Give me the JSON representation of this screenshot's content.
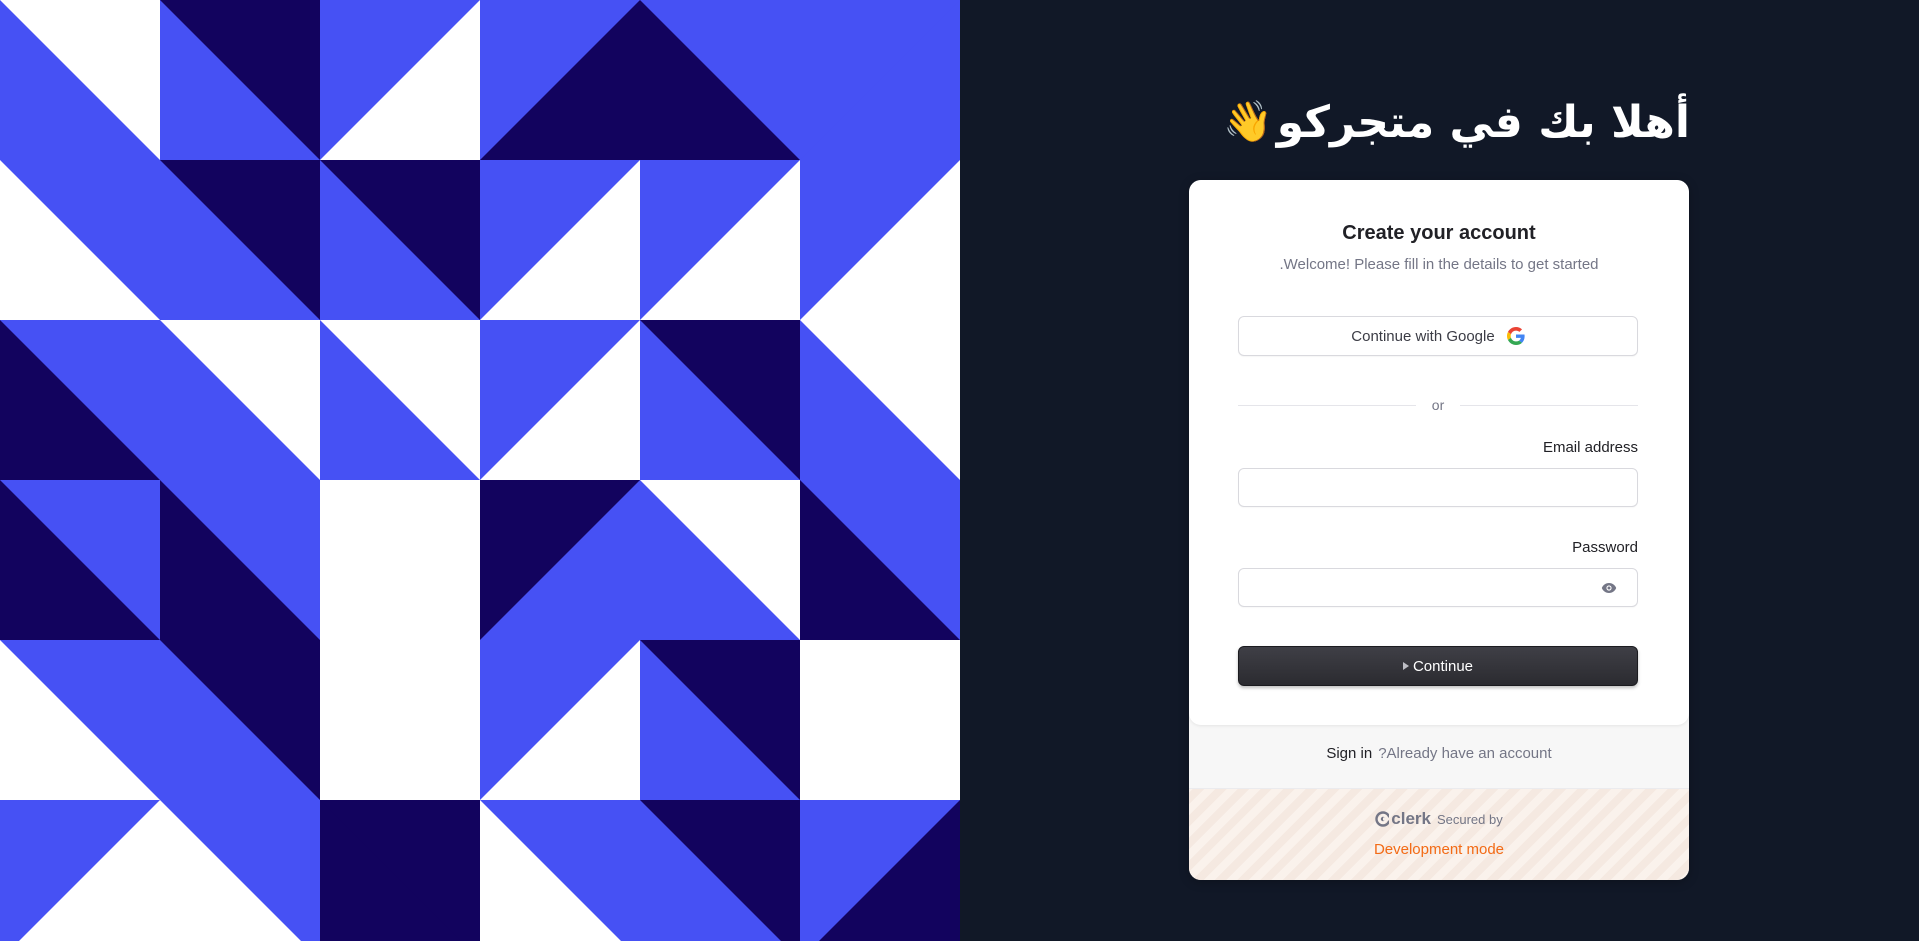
{
  "hero": {
    "title": "أهلا بك في متجركو",
    "emoji": "👋"
  },
  "card": {
    "title": "Create your account",
    "subtitle": "Welcome! Please fill in the details to get started.",
    "google_button_label": "Continue with Google",
    "divider_label": "or",
    "email_label": "Email address",
    "email_value": "",
    "password_label": "Password",
    "password_value": "",
    "continue_label": "Continue",
    "signin_link": "Sign in",
    "signin_prompt": "Already have an account?",
    "secured_by": "Secured by",
    "brand": "clerk",
    "dev_mode": "Development mode"
  },
  "colors": {
    "page_bg": "#111827",
    "pattern_blue": "#4651f4",
    "pattern_navy": "#12035e",
    "pattern_white": "#ffffff",
    "dev_mode": "#f36b16"
  },
  "icons": {
    "google": "google-g-icon",
    "eye": "eye-icon",
    "continue_caret": "caret-right-icon",
    "clerk": "clerk-logo-icon"
  }
}
